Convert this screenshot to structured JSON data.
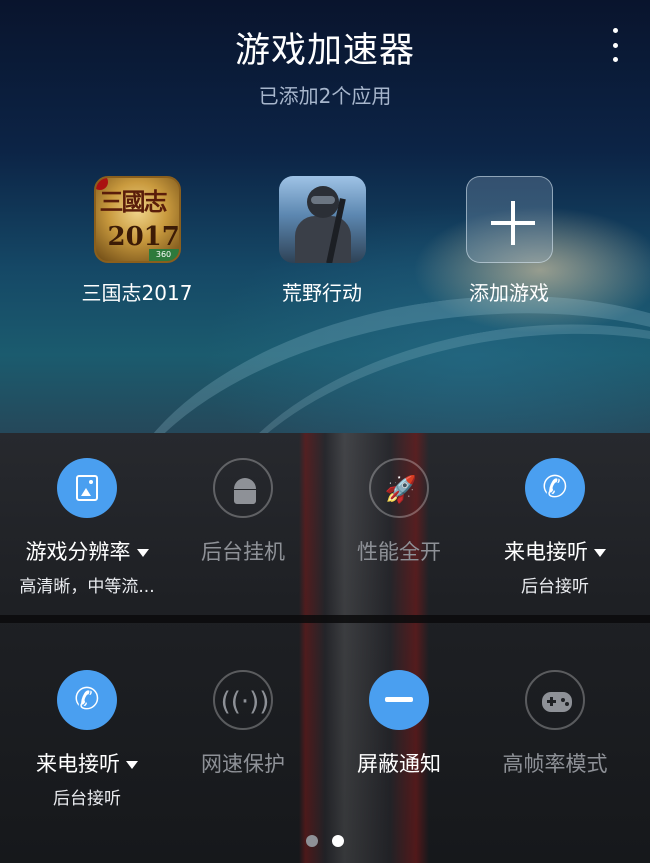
{
  "header": {
    "title": "游戏加速器",
    "subtitle": "已添加2个应用"
  },
  "apps": [
    {
      "label": "三国志2017",
      "icon": "sanguozhi-2017-icon",
      "icon_text": "三國志",
      "icon_year": "2017",
      "icon_badge": "360"
    },
    {
      "label": "荒野行动",
      "icon": "huangye-xingdong-icon"
    },
    {
      "label": "添加游戏",
      "icon": "plus-icon"
    }
  ],
  "settings_row1": [
    {
      "label": "游戏分辨率",
      "sub": "高清晰，中等流...",
      "icon": "image-icon",
      "active": true,
      "dropdown": true
    },
    {
      "label": "后台挂机",
      "icon": "android-icon",
      "active": false
    },
    {
      "label": "性能全开",
      "icon": "rocket-icon",
      "active": false
    },
    {
      "label": "来电接听",
      "sub": "后台接听",
      "icon": "phone-icon",
      "active": true,
      "dropdown": true
    }
  ],
  "settings_row2": [
    {
      "label": "来电接听",
      "sub": "后台接听",
      "icon": "phone-icon",
      "active": true,
      "dropdown": true
    },
    {
      "label": "网速保护",
      "icon": "signal-icon",
      "active": false
    },
    {
      "label": "屏蔽通知",
      "icon": "minus-icon",
      "active": true
    },
    {
      "label": "高帧率模式",
      "icon": "gamepad-icon",
      "active": false
    }
  ],
  "pagination": {
    "pages": 2,
    "current": 2
  },
  "colors": {
    "accent": "#4a9ff0",
    "inactive_text": "#8e9197"
  }
}
